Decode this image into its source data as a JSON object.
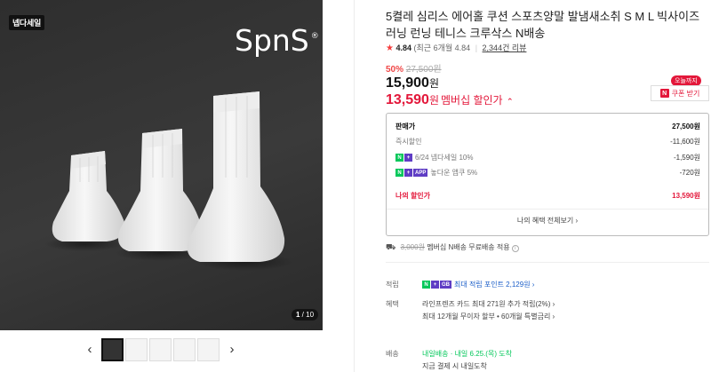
{
  "gallery": {
    "badge": "넵다세일",
    "brand": "SpnS",
    "brand_mark": "®",
    "counter_current": "1",
    "counter_total": "10",
    "prev_icon": "‹",
    "next_icon": "›"
  },
  "product": {
    "title": "5켤레 심리스 에어홀 쿠션 스포츠양말 발냄새소취 S M L 빅사이즈 러닝 런닝 테니스 크루삭스 N배송",
    "rating": "4.84",
    "rating_note": "(최근 6개월 4.84",
    "review_count": "2,344건 리뷰",
    "discount_rate": "50%",
    "original_price": "27,500원",
    "price": "15,900",
    "price_unit": "원",
    "member_price": "13,590",
    "member_unit": "원",
    "member_label": "멤버십 할인가",
    "today_tag": "오늘까지",
    "coupon_label": "쿠폰 받기",
    "coupon_icon": "N"
  },
  "pricebox": {
    "rows": [
      {
        "label": "판매가",
        "value": "27,500원"
      },
      {
        "label": "즉시할인",
        "value": "-11,600원"
      },
      {
        "label": "6/24 넵다세일 10%",
        "value": "-1,590원"
      },
      {
        "label": "놓다운 앱쿠 5%",
        "value": "-720원"
      },
      {
        "label": "나의 할인가",
        "value": "13,590원"
      }
    ],
    "app_badge": "APP",
    "all_benefits": "나의 혜택 전체보기 ›"
  },
  "shipping": {
    "old_fee": "3,000원",
    "text": "멤버십 N배송 무료배송 적용",
    "info": "i"
  },
  "details": {
    "points_label": "적립",
    "points_badge": "GB",
    "points_text": "최대 적립 포인트 2,129원 ›",
    "benefit_label": "혜택",
    "benefit_line1": "라인프렌즈 카드 최대 271원 추가 적립(2%) ›",
    "benefit_line2": "최대 12개월 무이자 할부 • 60개월 특별금리 ›",
    "delivery_label": "배송",
    "delivery_brand": "내일배송",
    "delivery_text": "· 내일 6.25.(목) 도착",
    "delivery_note": "지금 결제 시 내일도착"
  },
  "colors": {
    "accent_red": "#e3173a",
    "naver_green": "#03c75a",
    "member_purple": "#5f3dc4"
  }
}
